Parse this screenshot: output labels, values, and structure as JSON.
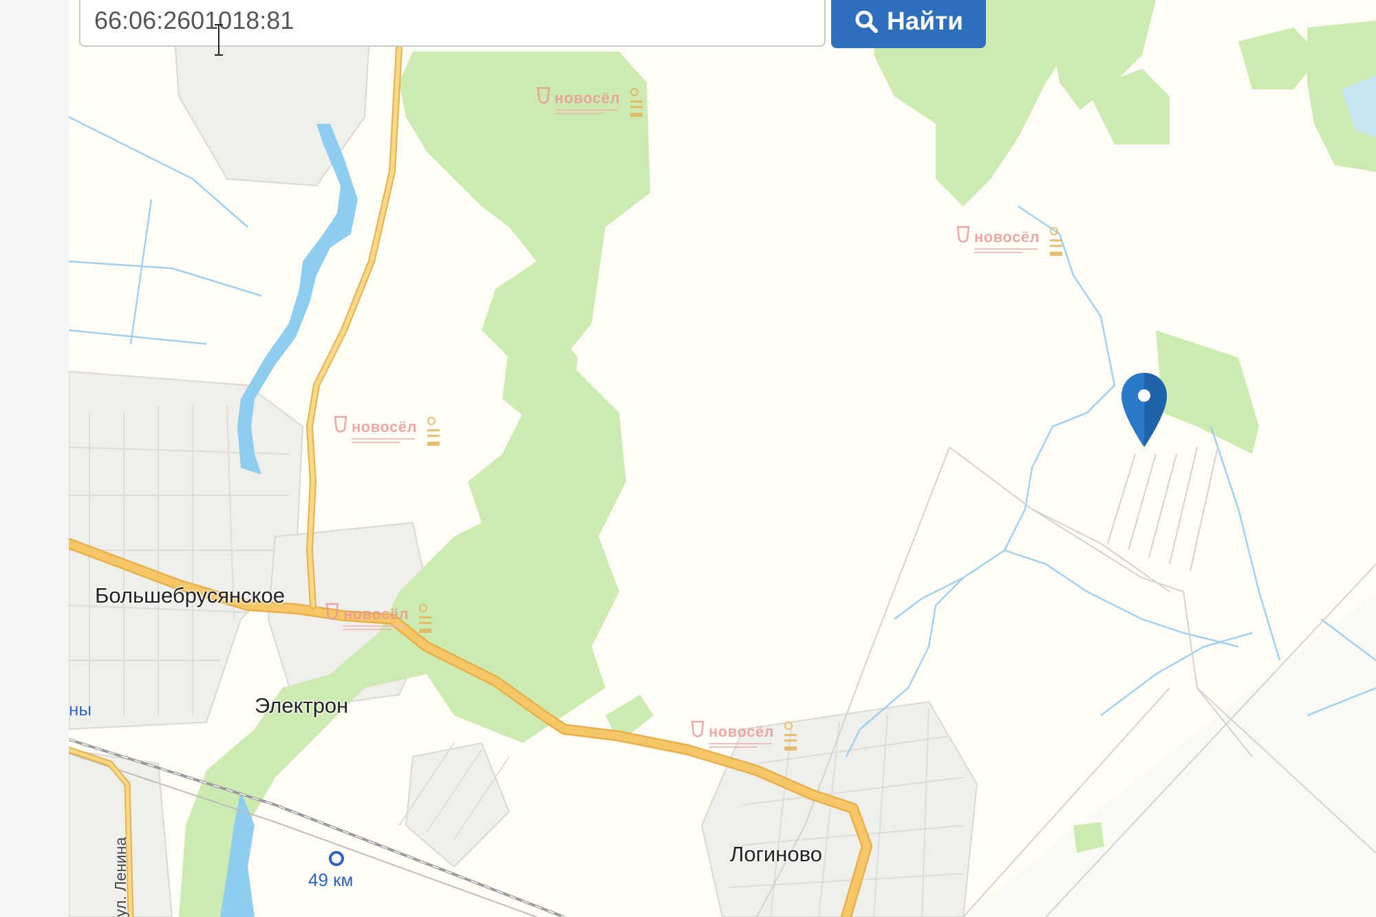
{
  "search": {
    "query": "66:06:2601018:81",
    "button_label": "Найти",
    "button_icon": "search-icon",
    "button_color": "#2d6fbd"
  },
  "map": {
    "background_color": "#fffdf6",
    "forest_color": "#cdeab1",
    "water_color": "#8ccdf0",
    "road_color": "#f6c766",
    "places": {
      "bolshebrusyanskoe": "Большебрусянское",
      "elektron": "Электрон",
      "loginovo": "Логиново",
      "partial_left": "ны"
    },
    "street": "ул. Ленина",
    "station": "49 км",
    "watermark": {
      "icon": "novosel-logo"
    },
    "marker": {
      "icon": "location-pin-icon",
      "color": "#2a78c8"
    }
  }
}
